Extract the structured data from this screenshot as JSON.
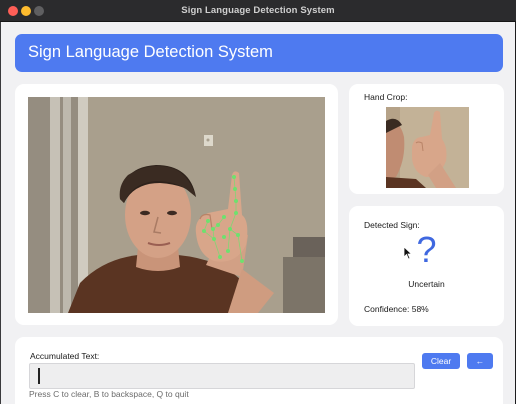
{
  "window": {
    "title": "Sign Language Detection System"
  },
  "header": {
    "title": "Sign Language Detection System"
  },
  "hand_crop": {
    "label": "Hand Crop:"
  },
  "detection": {
    "label": "Detected Sign:",
    "sign": "?",
    "status": "Uncertain",
    "confidence_text": "Confidence: 58%",
    "confidence": 0.58
  },
  "accumulated": {
    "label": "Accumulated Text:",
    "value": "",
    "hint": "Press C to clear, B to backspace, Q to quit"
  },
  "buttons": {
    "clear": "Clear",
    "backspace": "←"
  },
  "colors": {
    "accent": "#4e7af0",
    "sign_glyph": "#3f68e0",
    "background": "#f1f1f3",
    "card": "#ffffff",
    "landmark": "#6fe06f"
  },
  "icons": [
    "close-icon",
    "minimize-icon",
    "maximize-icon",
    "pointer-cursor-icon"
  ]
}
